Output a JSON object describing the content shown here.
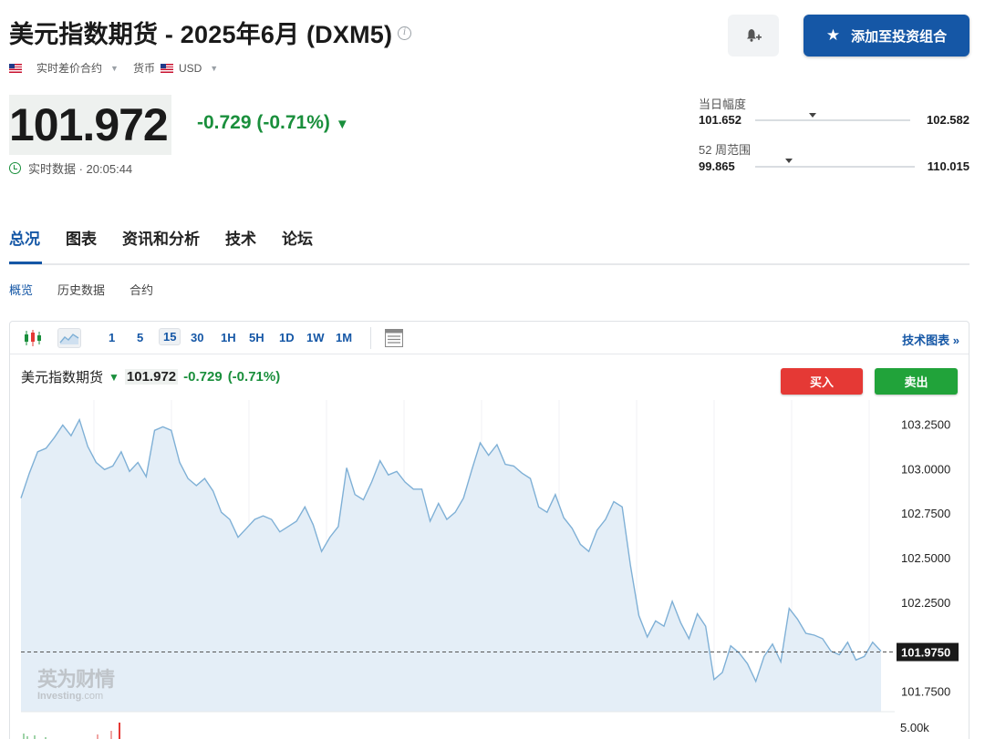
{
  "header": {
    "title": "美元指数期货 - 2025年6月 (DXM5)",
    "add_portfolio_label": "添加至投资组合",
    "bell_icon": "bell-plus-icon",
    "star_icon": "star-icon"
  },
  "meta": {
    "contract_type": "实时差价合约",
    "currency_label": "货币",
    "currency": "USD"
  },
  "quote": {
    "price": "101.972",
    "change": "-0.729 (-0.71%)",
    "time_label": "实时数据 · 20:05:44"
  },
  "ranges": {
    "day_label": "当日幅度",
    "day_low": "101.652",
    "day_high": "102.582",
    "day_position": 0.37,
    "week52_label": "52 周范围",
    "week52_low": "99.865",
    "week52_high": "110.015",
    "week52_position": 0.21
  },
  "tabs": [
    "总况",
    "图表",
    "资讯和分析",
    "技术",
    "论坛"
  ],
  "active_tab": 0,
  "subtabs": [
    "概览",
    "历史数据",
    "合约"
  ],
  "active_subtab": 0,
  "toolbar": {
    "timeframes": [
      "1",
      "5",
      "15",
      "30",
      "1H",
      "5H",
      "1D",
      "1W",
      "1M"
    ],
    "active_timeframe": "15",
    "tech_chart_label": "技术图表 »"
  },
  "chart_legend": {
    "name": "美元指数期货",
    "price": "101.972",
    "change": "-0.729",
    "percent": "(-0.71%)"
  },
  "trade": {
    "buy_label": "买入",
    "sell_label": "卖出"
  },
  "watermark": "英为财情 Investing.com",
  "colors": {
    "brand_blue": "#1557a6",
    "down_green": "#1a8f3c",
    "buy_red": "#e53935",
    "sell_green": "#21a33a",
    "line": "#7fb0d6",
    "area": "#e4eef7"
  },
  "chart_data": {
    "type": "area",
    "title": "",
    "xlabel": "",
    "ylabel": "",
    "ylim": [
      101.64,
      103.36
    ],
    "yticks": [
      "103.2500",
      "103.0000",
      "102.7500",
      "102.5000",
      "102.2500",
      "101.7500"
    ],
    "current_value_label": "101.9750",
    "current_value": 101.975,
    "volume_axis_label": "5.00k",
    "series": [
      {
        "values": [
          102.84,
          102.98,
          103.1,
          103.12,
          103.18,
          103.25,
          103.19,
          103.28,
          103.13,
          103.04,
          103.0,
          103.02,
          103.1,
          102.99,
          103.04,
          102.96,
          103.22,
          103.24,
          103.22,
          103.04,
          102.95,
          102.91,
          102.95,
          102.88,
          102.76,
          102.72,
          102.62,
          102.67,
          102.72,
          102.74,
          102.72,
          102.65,
          102.68,
          102.71,
          102.79,
          102.69,
          102.54,
          102.62,
          102.68,
          103.01,
          102.86,
          102.83,
          102.93,
          103.05,
          102.97,
          102.99,
          102.93,
          102.89,
          102.89,
          102.71,
          102.81,
          102.72,
          102.76,
          102.84,
          103.0,
          103.15,
          103.08,
          103.14,
          103.03,
          103.02,
          102.98,
          102.95,
          102.79,
          102.76,
          102.86,
          102.73,
          102.67,
          102.58,
          102.54,
          102.66,
          102.72,
          102.82,
          102.79,
          102.46,
          102.18,
          102.06,
          102.15,
          102.12,
          102.26,
          102.14,
          102.05,
          102.19,
          102.12,
          101.82,
          101.86,
          102.01,
          101.97,
          101.91,
          101.81,
          101.95,
          102.02,
          101.92,
          102.22,
          102.16,
          102.08,
          102.07,
          102.05,
          101.98,
          101.96,
          102.03,
          101.93,
          101.95,
          102.03,
          101.98
        ]
      }
    ]
  }
}
